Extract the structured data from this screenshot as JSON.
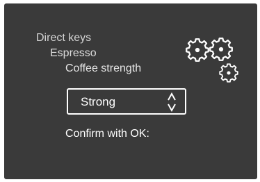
{
  "breadcrumb": {
    "items": [
      "Direct keys",
      "Espresso",
      "Coffee strength"
    ]
  },
  "selector": {
    "value": "Strong"
  },
  "prompt": {
    "text": "Confirm with OK:"
  },
  "icons": {
    "settings": "gears-icon",
    "spinner": "up-down-arrows-icon"
  },
  "colors": {
    "background": "#3a3a3a",
    "text": "#ffffff"
  }
}
